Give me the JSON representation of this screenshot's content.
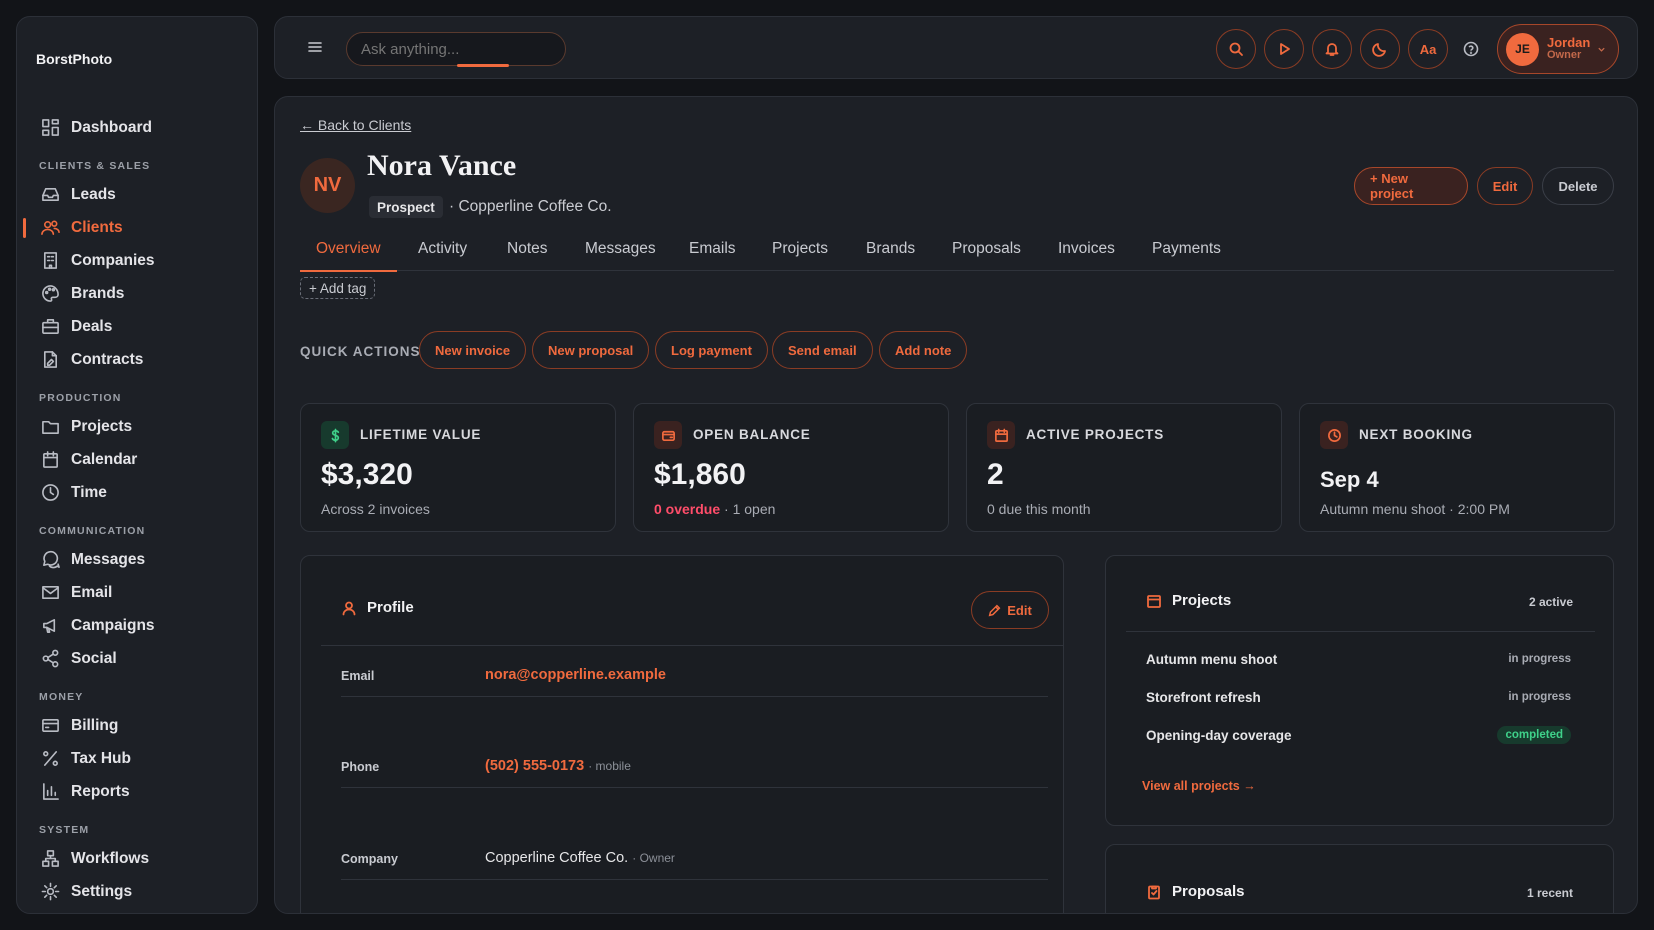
{
  "app": {
    "brand": "BorstPhoto"
  },
  "sidebar": {
    "dashboard": "Dashboard",
    "sections": {
      "clients": "CLIENTS & SALES",
      "production": "PRODUCTION",
      "communication": "COMMUNICATION",
      "money": "MONEY",
      "system": "SYSTEM"
    },
    "items": {
      "leads": "Leads",
      "clients": "Clients",
      "companies": "Companies",
      "brands": "Brands",
      "deals": "Deals",
      "contracts": "Contracts",
      "projects": "Projects",
      "calendar": "Calendar",
      "time": "Time",
      "messages": "Messages",
      "email": "Email",
      "campaigns": "Campaigns",
      "social": "Social",
      "billing": "Billing",
      "taxhub": "Tax Hub",
      "reports": "Reports",
      "workflows": "Workflows",
      "settings": "Settings"
    }
  },
  "topbar": {
    "ask_placeholder": "Ask anything...",
    "font_btn": "Aa",
    "user": {
      "initials": "JE",
      "name": "Jordan",
      "role": "Owner"
    }
  },
  "client": {
    "back": "← Back to Clients",
    "initials": "NV",
    "name": "Nora Vance",
    "status": "Prospect",
    "company_line": "· Copperline Coffee Co.",
    "actions": {
      "new_project": "+ New project",
      "edit": "Edit",
      "delete": "Delete"
    },
    "tabs": [
      "Overview",
      "Activity",
      "Notes",
      "Messages",
      "Emails",
      "Projects",
      "Brands",
      "Proposals",
      "Invoices",
      "Payments"
    ],
    "add_tag": "+ Add tag"
  },
  "quick_actions": {
    "label": "QUICK ACTIONS",
    "items": [
      "New invoice",
      "New proposal",
      "Log payment",
      "Send email",
      "Add note"
    ]
  },
  "stats": [
    {
      "title": "LIFETIME VALUE",
      "value": "$3,320",
      "sub": "Across 2 invoices"
    },
    {
      "title": "OPEN BALANCE",
      "value": "$1,860",
      "sub_overdue": "0 overdue",
      "sub": "· 1 open"
    },
    {
      "title": "ACTIVE PROJECTS",
      "value": "2",
      "sub": "0 due this month"
    },
    {
      "title": "NEXT BOOKING",
      "value": "Sep 4",
      "sub": "Autumn menu shoot · 2:00 PM"
    }
  ],
  "profile": {
    "title": "Profile",
    "edit": "Edit",
    "email_label": "Email",
    "email": "nora@copperline.example",
    "phone_label": "Phone",
    "phone": "(502) 555-0173",
    "phone_note": "· mobile",
    "company_label": "Company",
    "company": "Copperline Coffee Co.",
    "company_note": "· Owner"
  },
  "projects": {
    "title": "Projects",
    "count": "2 active",
    "items": [
      {
        "name": "Autumn menu shoot",
        "status": "in progress"
      },
      {
        "name": "Storefront refresh",
        "status": "in progress"
      },
      {
        "name": "Opening-day coverage",
        "status": "completed"
      }
    ],
    "view_all": "View all projects →"
  },
  "proposals": {
    "title": "Proposals",
    "count": "1 recent"
  },
  "colors": {
    "accent": "#f06a3e",
    "success": "#3fd18a",
    "danger": "#ff4d6a",
    "background": "#121418",
    "panel": "#1d2026"
  }
}
